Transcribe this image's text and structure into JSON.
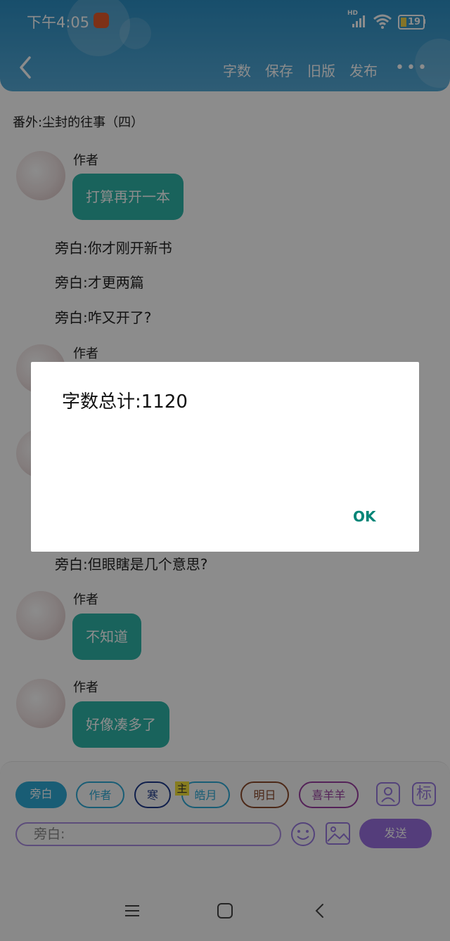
{
  "status_bar": {
    "time": "下午4:05",
    "network": "HD",
    "battery": "19"
  },
  "header": {
    "buttons": {
      "word_count": "字数",
      "save": "保存",
      "old_version": "旧版",
      "publish": "发布"
    }
  },
  "chapter_title": "番外:尘封的往事（四）",
  "chat": {
    "author_name": "作者",
    "msg1": "打算再开一本",
    "narr1": "旁白:你才刚开新书",
    "narr2": "旁白:才更两篇",
    "narr3": "旁白:咋又开了?",
    "narr4": "旁白:但眼瞎是几个意思?",
    "msg_last1": "不知道",
    "msg_last2": "好像凑多了"
  },
  "composer": {
    "chips": [
      {
        "label": "旁白"
      },
      {
        "label": "作者"
      },
      {
        "label": "寒"
      },
      {
        "label": "皓月",
        "badge": "主"
      },
      {
        "label": "明日"
      },
      {
        "label": "喜羊羊"
      }
    ],
    "tag_button": "标",
    "input_placeholder": "旁白:",
    "send": "发送"
  },
  "dialog": {
    "title": "字数总计:1120",
    "ok": "OK"
  },
  "colors": {
    "accent": "#2eb5a8",
    "header": "#2c8fc4",
    "purple": "#9a6fe0",
    "ok": "#008577"
  }
}
